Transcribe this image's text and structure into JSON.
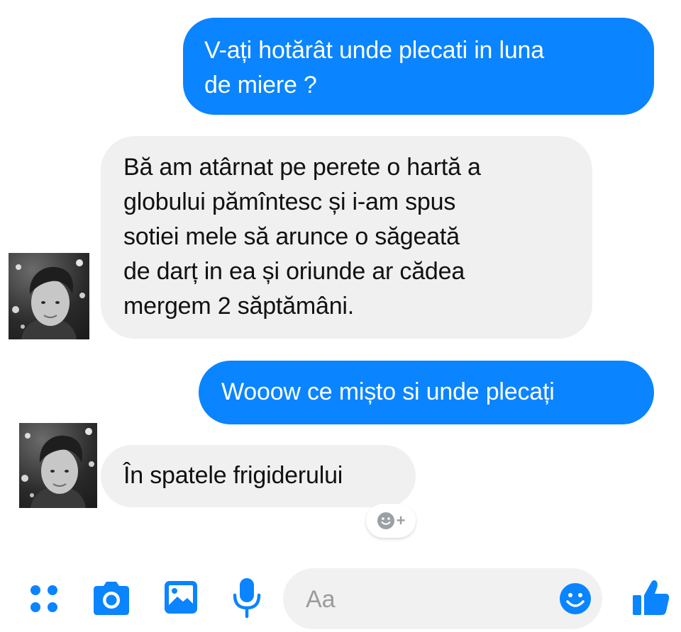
{
  "messages": [
    {
      "direction": "outgoing",
      "lines": [
        "V-ați hotărât unde plecati in luna",
        "de miere ?"
      ]
    },
    {
      "direction": "incoming",
      "lines": [
        "Bă am atârnat pe perete o hartă a",
        "globului pămîntesc și i-am spus",
        "sotiei mele să arunce o săgeată",
        "de darț in ea și oriunde ar cădea",
        "mergem 2 săptămâni."
      ]
    },
    {
      "direction": "outgoing",
      "lines": [
        "Wooow ce mișto si unde plecați"
      ]
    },
    {
      "direction": "incoming",
      "lines": [
        "În spatele frigiderului"
      ]
    }
  ],
  "reaction": {
    "icon": "smiley-add-icon",
    "plus": "+"
  },
  "toolbar": {
    "icons": [
      "apps-grid-icon",
      "camera-icon",
      "gallery-icon",
      "microphone-icon"
    ],
    "composer_placeholder": "Aa",
    "emoji_icon": "emoji-icon",
    "like_icon": "thumbs-up-icon"
  },
  "colors": {
    "accent": "#0a84ff",
    "incoming_bubble": "#f0f0f0",
    "text": "#111111"
  }
}
